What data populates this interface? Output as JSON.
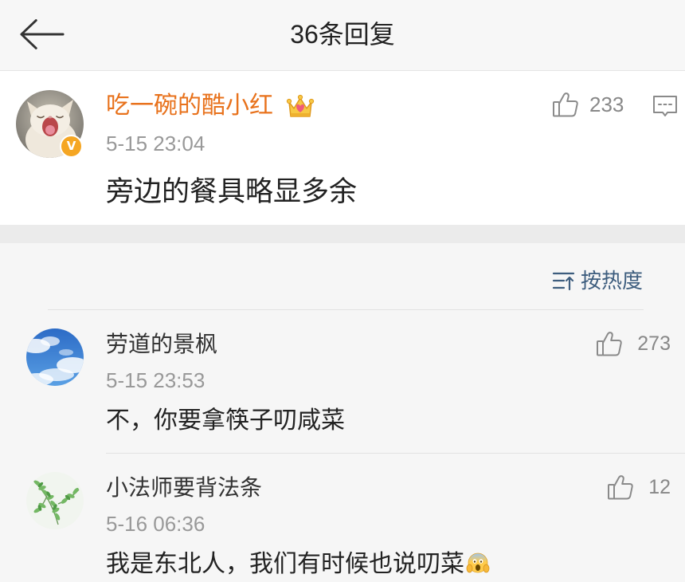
{
  "header": {
    "title": "36条回复",
    "back_icon": "back-arrow-icon"
  },
  "main_comment": {
    "username": "吃一碗的酷小红",
    "verified_label": "V",
    "member_badge_icon": "crown-icon",
    "avatar": "yawning-cat-avatar",
    "timestamp": "5-15 23:04",
    "text": "旁边的餐具略显多余",
    "likes": "233",
    "like_icon": "thumbs-up-icon",
    "reply_icon": "comment-icon"
  },
  "sort": {
    "label": "按热度",
    "icon": "sort-icon"
  },
  "replies": [
    {
      "username": "劳道的景枫",
      "avatar": "sky-clouds-avatar",
      "timestamp": "5-15 23:53",
      "text": "不，你要拿筷子叨咸菜",
      "likes": "273",
      "like_icon": "thumbs-up-icon"
    },
    {
      "username": "小法师要背法条",
      "avatar": "green-leaves-avatar",
      "timestamp": "5-16 06:36",
      "text": "我是东北人，我们有时候也说叨菜",
      "trailing_emoji": "scream-emoji-icon",
      "likes": "12",
      "like_icon": "thumbs-up-icon"
    }
  ],
  "colors": {
    "username_accent": "#e8721c",
    "sort_link": "#3d5d7e",
    "verified_badge": "#f5a623",
    "text_primary": "#222222",
    "text_secondary": "#999999",
    "divider": "#e2e2e2"
  }
}
